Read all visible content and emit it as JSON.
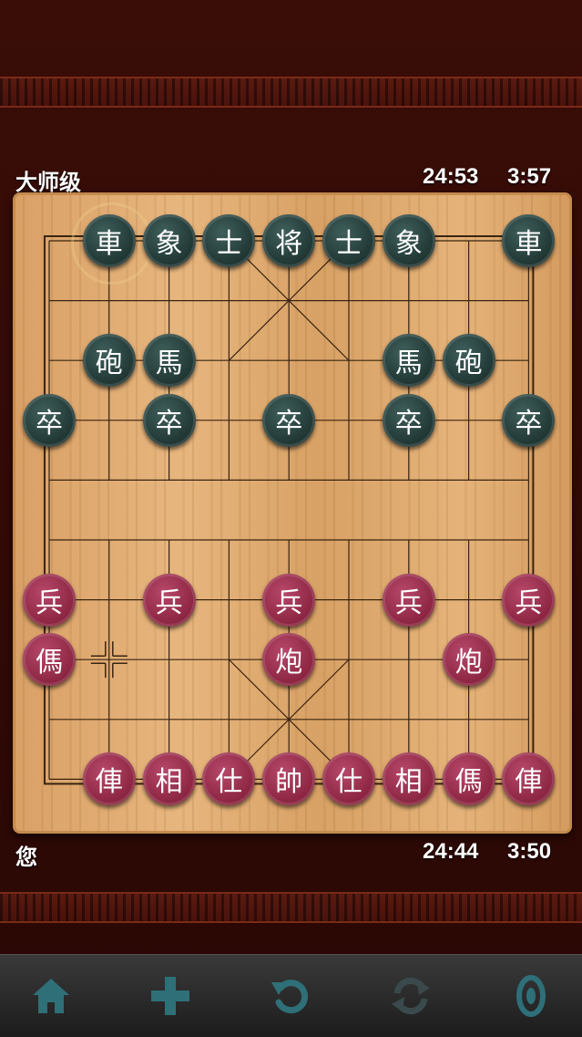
{
  "opponent": {
    "name": "大师级",
    "clock_total": "24:53",
    "clock_move": "3:57"
  },
  "player": {
    "name": "您",
    "clock_total": "24:44",
    "clock_move": "3:50"
  },
  "board": {
    "pieces": [
      {
        "side": "black",
        "char": "車",
        "file": 1,
        "rank": 0
      },
      {
        "side": "black",
        "char": "象",
        "file": 2,
        "rank": 0
      },
      {
        "side": "black",
        "char": "士",
        "file": 3,
        "rank": 0
      },
      {
        "side": "black",
        "char": "将",
        "file": 4,
        "rank": 0
      },
      {
        "side": "black",
        "char": "士",
        "file": 5,
        "rank": 0
      },
      {
        "side": "black",
        "char": "象",
        "file": 6,
        "rank": 0
      },
      {
        "side": "black",
        "char": "車",
        "file": 8,
        "rank": 0
      },
      {
        "side": "black",
        "char": "砲",
        "file": 1,
        "rank": 2
      },
      {
        "side": "black",
        "char": "馬",
        "file": 2,
        "rank": 2
      },
      {
        "side": "black",
        "char": "馬",
        "file": 6,
        "rank": 2
      },
      {
        "side": "black",
        "char": "砲",
        "file": 7,
        "rank": 2
      },
      {
        "side": "black",
        "char": "卒",
        "file": 0,
        "rank": 3
      },
      {
        "side": "black",
        "char": "卒",
        "file": 2,
        "rank": 3
      },
      {
        "side": "black",
        "char": "卒",
        "file": 4,
        "rank": 3
      },
      {
        "side": "black",
        "char": "卒",
        "file": 6,
        "rank": 3
      },
      {
        "side": "black",
        "char": "卒",
        "file": 8,
        "rank": 3
      },
      {
        "side": "red",
        "char": "兵",
        "file": 0,
        "rank": 6
      },
      {
        "side": "red",
        "char": "兵",
        "file": 2,
        "rank": 6
      },
      {
        "side": "red",
        "char": "兵",
        "file": 4,
        "rank": 6
      },
      {
        "side": "red",
        "char": "兵",
        "file": 6,
        "rank": 6
      },
      {
        "side": "red",
        "char": "兵",
        "file": 8,
        "rank": 6
      },
      {
        "side": "red",
        "char": "傌",
        "file": 0,
        "rank": 7
      },
      {
        "side": "red",
        "char": "炮",
        "file": 4,
        "rank": 7
      },
      {
        "side": "red",
        "char": "炮",
        "file": 7,
        "rank": 7
      },
      {
        "side": "red",
        "char": "俥",
        "file": 1,
        "rank": 9
      },
      {
        "side": "red",
        "char": "相",
        "file": 2,
        "rank": 9
      },
      {
        "side": "red",
        "char": "仕",
        "file": 3,
        "rank": 9
      },
      {
        "side": "red",
        "char": "帥",
        "file": 4,
        "rank": 9
      },
      {
        "side": "red",
        "char": "仕",
        "file": 5,
        "rank": 9
      },
      {
        "side": "red",
        "char": "相",
        "file": 6,
        "rank": 9
      },
      {
        "side": "red",
        "char": "傌",
        "file": 7,
        "rank": 9
      },
      {
        "side": "red",
        "char": "俥",
        "file": 8,
        "rank": 9
      }
    ],
    "last_move_from": {
      "file": 1,
      "rank": 0
    },
    "last_move_to": {
      "file": 1,
      "rank": 7
    }
  },
  "toolbar": [
    {
      "icon": "home-icon",
      "enabled": true
    },
    {
      "icon": "plus-icon",
      "enabled": true
    },
    {
      "icon": "undo-icon",
      "enabled": true
    },
    {
      "icon": "swap-icon",
      "enabled": false
    },
    {
      "icon": "sound-icon",
      "enabled": true
    }
  ],
  "colors": {
    "icon_active": "#2e6f78",
    "icon_disabled": "#3a4a4c",
    "red_piece": "#8a2440",
    "black_piece": "#1f3532"
  }
}
